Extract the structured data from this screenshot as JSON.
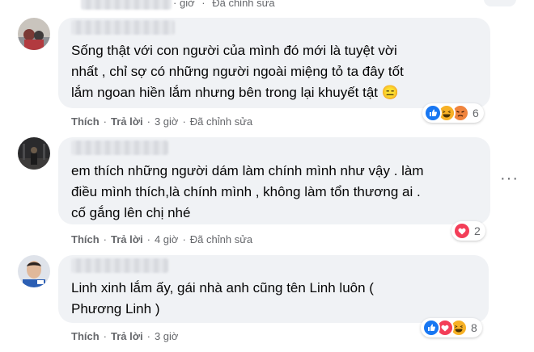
{
  "top_partial": {
    "time": "giờ",
    "edited": "Đã chỉnh sửa"
  },
  "comments": [
    {
      "text": "Sống thật với con người của mình đó mới là tuyệt vời\nnhất , chỉ sợ có những người ngoài miệng tỏ ta đây tốt\nlắm ngoan hiền lắm nhưng bên trong lại khuyết tật 😑",
      "like": "Thích",
      "reply": "Trả lời",
      "time": "3 giờ",
      "edited": "Đã chỉnh sửa",
      "reaction_count": "6",
      "reactions": [
        "like-reaction",
        "haha-reaction",
        "angry-reaction"
      ]
    },
    {
      "text": "em thích những người dám làm chính mình như vậy . làm\nđiều mình thích,là chính mình , không làm tổn thương ai .\ncố gắng lên chị nhé",
      "like": "Thích",
      "reply": "Trả lời",
      "time": "4 giờ",
      "edited": "Đã chỉnh sửa",
      "reaction_count": "2",
      "reactions": [
        "love-reaction"
      ]
    },
    {
      "text": "Linh xinh lắm ấy, gái nhà anh cũng tên Linh luôn (\nPhương Linh )",
      "like": "Thích",
      "reply": "Trả lời",
      "time": "3 giờ",
      "edited": "",
      "reaction_count": "8",
      "reactions": [
        "like-reaction",
        "love-reaction",
        "haha-reaction"
      ]
    }
  ],
  "more_options": "···",
  "colors": {
    "bubble": "#f0f2f5",
    "secondary_text": "#65676b",
    "like": "#1877f2",
    "love": "#f33e58",
    "haha": "#f7b125"
  }
}
